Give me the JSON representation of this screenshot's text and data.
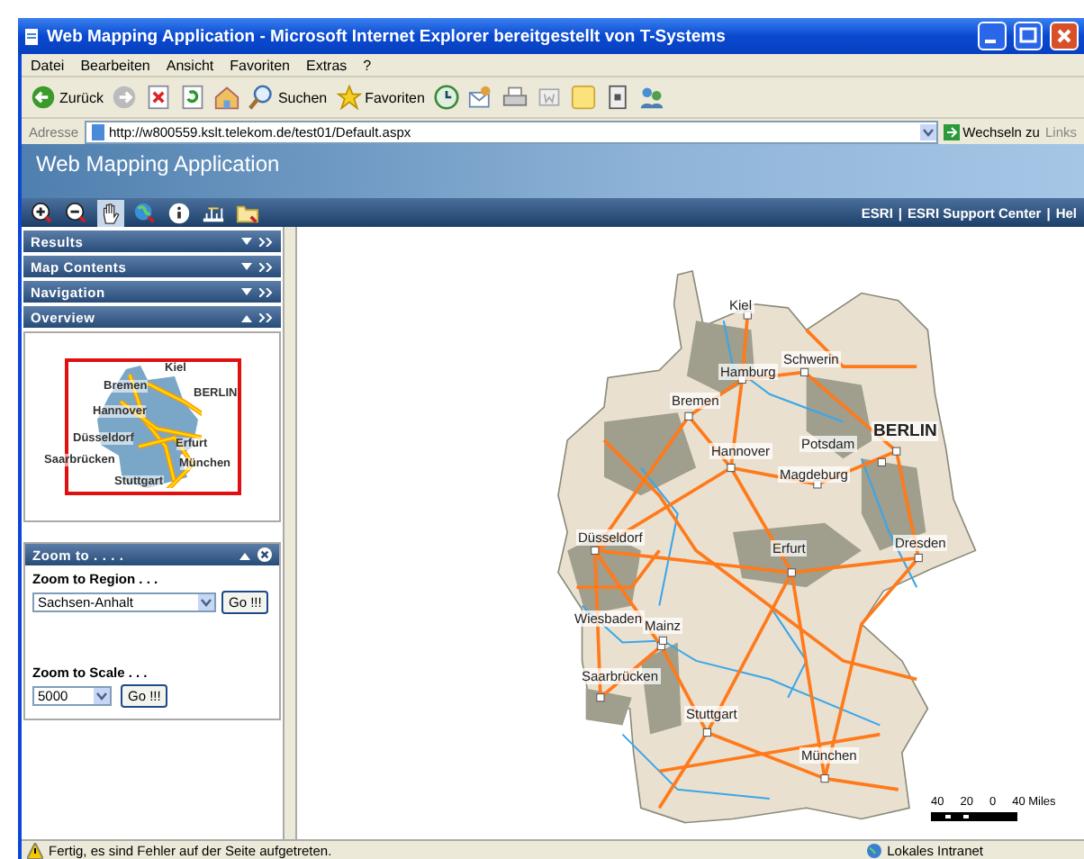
{
  "window": {
    "title": "Web Mapping Application - Microsoft Internet Explorer bereitgestellt von T-Systems"
  },
  "menu": [
    "Datei",
    "Bearbeiten",
    "Ansicht",
    "Favoriten",
    "Extras",
    "?"
  ],
  "toolbar": [
    {
      "kind": "back",
      "label": "Zurück"
    },
    {
      "kind": "forward"
    },
    {
      "kind": "stop"
    },
    {
      "kind": "refresh"
    },
    {
      "kind": "home"
    },
    {
      "kind": "search",
      "label": "Suchen"
    },
    {
      "kind": "favorites",
      "label": "Favoriten"
    },
    {
      "kind": "history"
    },
    {
      "kind": "mail"
    },
    {
      "kind": "print"
    },
    {
      "kind": "edit"
    },
    {
      "kind": "note"
    },
    {
      "kind": "device"
    },
    {
      "kind": "people"
    }
  ],
  "address": {
    "label": "Adresse",
    "value": "http://w800559.kslt.telekom.de/test01/Default.aspx",
    "go": "Wechseln zu",
    "links": "Links"
  },
  "app": {
    "title": "Web Mapping Application",
    "links": [
      "ESRI",
      "ESRI Support Center",
      "Hel"
    ],
    "separator": "|"
  },
  "map_tools": [
    {
      "kind": "zoom-in",
      "selected": false
    },
    {
      "kind": "zoom-out",
      "selected": false
    },
    {
      "kind": "pan",
      "selected": true
    },
    {
      "kind": "globe",
      "selected": false
    },
    {
      "kind": "info",
      "selected": false
    },
    {
      "kind": "measure",
      "selected": false
    },
    {
      "kind": "folder",
      "selected": false
    }
  ],
  "panels": [
    {
      "title": "Results",
      "expanded": false
    },
    {
      "title": "Map Contents",
      "expanded": false
    },
    {
      "title": "Navigation",
      "expanded": false
    },
    {
      "title": "Overview",
      "expanded": true
    }
  ],
  "overview": {
    "cities": [
      "Kiel",
      "Bremen",
      "BERLIN",
      "Hannover",
      "Düsseldorf",
      "Erfurt",
      "Saarbrücken",
      "München",
      "Stuttgart"
    ]
  },
  "zoom_panel": {
    "title": "Zoom to . . . .",
    "region_label": "Zoom to Region . . .",
    "region_value": "Sachsen-Anhalt",
    "scale_label": "Zoom to Scale . . .",
    "scale_value": "5000",
    "region_button": "Go !!!",
    "scale_button": "Go !!!"
  },
  "map": {
    "cities": [
      "Kiel",
      "Hamburg",
      "Schwerin",
      "Bremen",
      "BERLIN",
      "Potsdam",
      "Hannover",
      "Magdeburg",
      "Düsseldorf",
      "Erfurt",
      "Dresden",
      "Wiesbaden",
      "Mainz",
      "Saarbrücken",
      "Stuttgart",
      "München"
    ],
    "scale_labels": [
      "40",
      "20",
      "0",
      "40 Miles"
    ]
  },
  "status_bar": {
    "message": "Fertig, es sind Fehler auf der Seite aufgetreten.",
    "zone": "Lokales Intranet"
  }
}
